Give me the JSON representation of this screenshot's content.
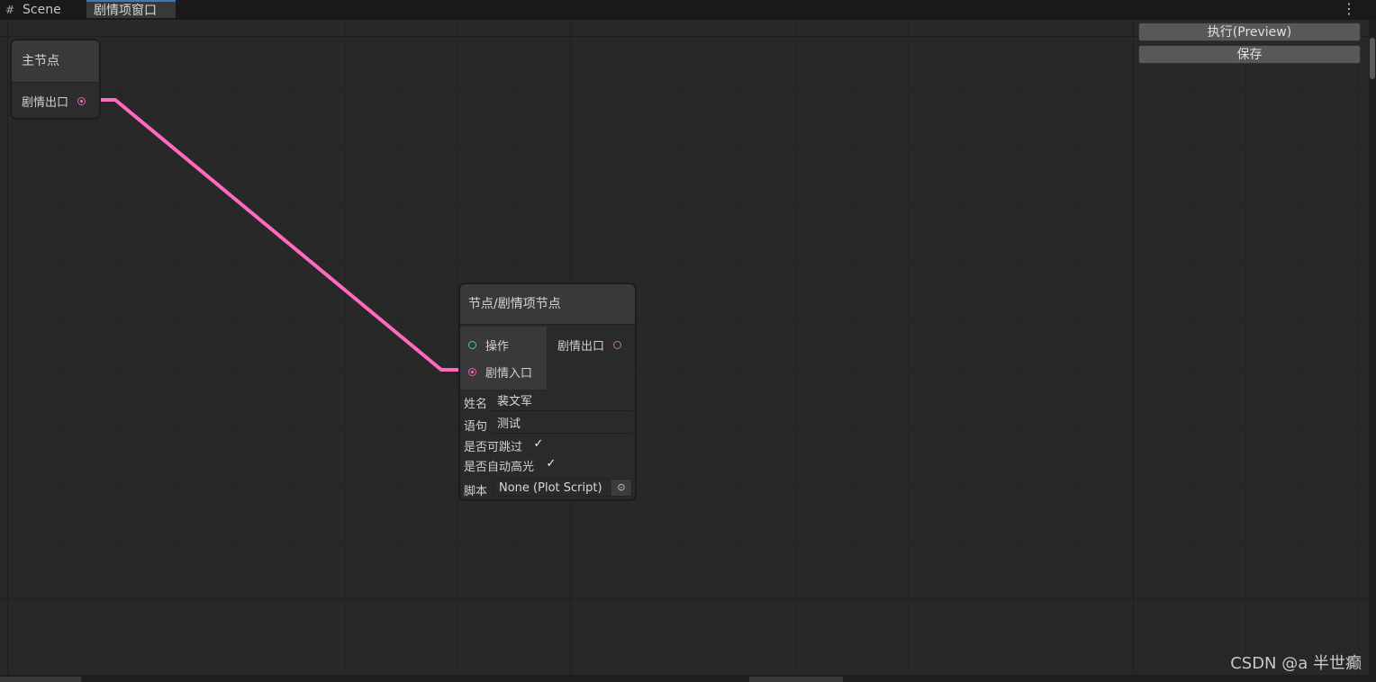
{
  "tabs": {
    "scene_label": "Scene",
    "active_label": "剧情项窗口"
  },
  "toolbar": {
    "preview_label": "执行(Preview)",
    "save_label": "保存"
  },
  "main_node": {
    "title": "主节点",
    "output_port": "剧情出口"
  },
  "plot_node": {
    "title": "节点/剧情项节点",
    "input_action": "操作",
    "input_plot": "剧情入口",
    "output_plot": "剧情出口",
    "name_label": "姓名",
    "name_value": "裴文军",
    "sentence_label": "语句",
    "sentence_value": "测试",
    "skippable_label": "是否可跳过",
    "skippable_checked": true,
    "autohighlight_label": "是否自动高光",
    "autohighlight_checked": true,
    "script_label": "脚本",
    "script_value": "None (Plot Script)"
  },
  "watermark": "CSDN @a 半世癫",
  "colors": {
    "edge": "#ff69c0",
    "action_port": "#3cc8d0",
    "background": "#282828"
  },
  "icons": {
    "scene_tab": "grid-icon",
    "menu": "kebab-menu-icon",
    "object_picker": "target-icon",
    "check": "checkmark-icon"
  }
}
